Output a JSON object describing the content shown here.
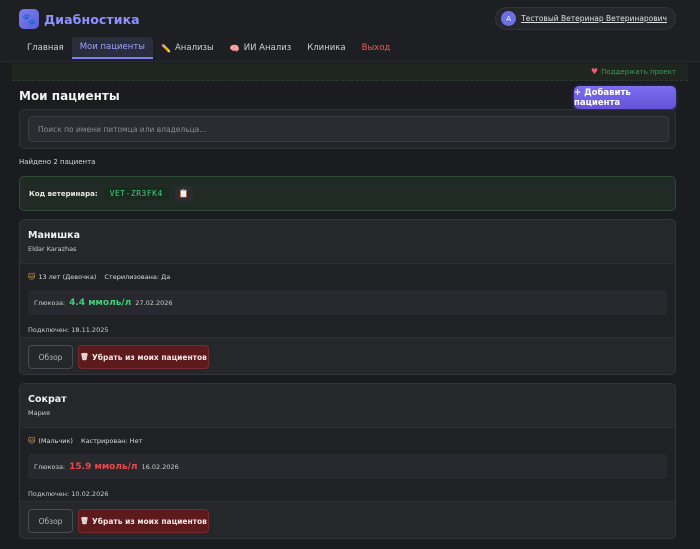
{
  "header": {
    "brand_name": "Диабностика",
    "brand_icon": "paw-icon",
    "user_initial": "А",
    "user_name": "Тестовый Ветеринар Ветеринарович"
  },
  "nav": {
    "items": [
      {
        "label": "Главная",
        "active": false
      },
      {
        "label": "Мои пациенты",
        "active": true
      },
      {
        "label": "Анализы",
        "icon": "✏️"
      },
      {
        "label": "ИИ Анализ",
        "icon": "🧠"
      },
      {
        "label": "Клиника"
      },
      {
        "label": "Выход"
      }
    ]
  },
  "support": {
    "label": "Поддержать проект"
  },
  "main": {
    "title": "Мои пациенты",
    "add_button": "+ Добавить пациента",
    "search_placeholder": "Поиск по имени питомца или владельца...",
    "found_text": "Найдено 2 пациента",
    "vet_code_label": "Код ветеринара:",
    "vet_code_value": "VET-ZR3FK4",
    "copy_icon": "📋"
  },
  "patients": [
    {
      "name": "Манишка",
      "owner": "Eldar Karazhas",
      "pet_icon": "🐱",
      "meta_age": "13 лет (Девочка)",
      "meta_sterile": "Стерилизована: Да",
      "glucose_label": "Глюкоза:",
      "glucose_value": "4.4 ммоль/л",
      "glucose_date": "27.02.2026",
      "glucose_status": "ok",
      "connected": "Подключен: 18.11.2025",
      "overview_label": "Обзор",
      "remove_label": "Убрать из моих пациентов"
    },
    {
      "name": "Сократ",
      "owner": "Мария",
      "pet_icon": "🐱",
      "meta_age": "(Мальчик)",
      "meta_sterile": "Кастрирован: Нет",
      "glucose_label": "Глюкоза:",
      "glucose_value": "15.9 ммоль/л",
      "glucose_date": "16.02.2026",
      "glucose_status": "high",
      "connected": "Подключен: 10.02.2026",
      "overview_label": "Обзор",
      "remove_label": "Убрать из моих пациентов"
    }
  ],
  "colors": {
    "accent": "#7b7ff0",
    "glucose_ok": "#3fd07a",
    "glucose_high": "#f04848",
    "danger": "#5c1a1c"
  }
}
